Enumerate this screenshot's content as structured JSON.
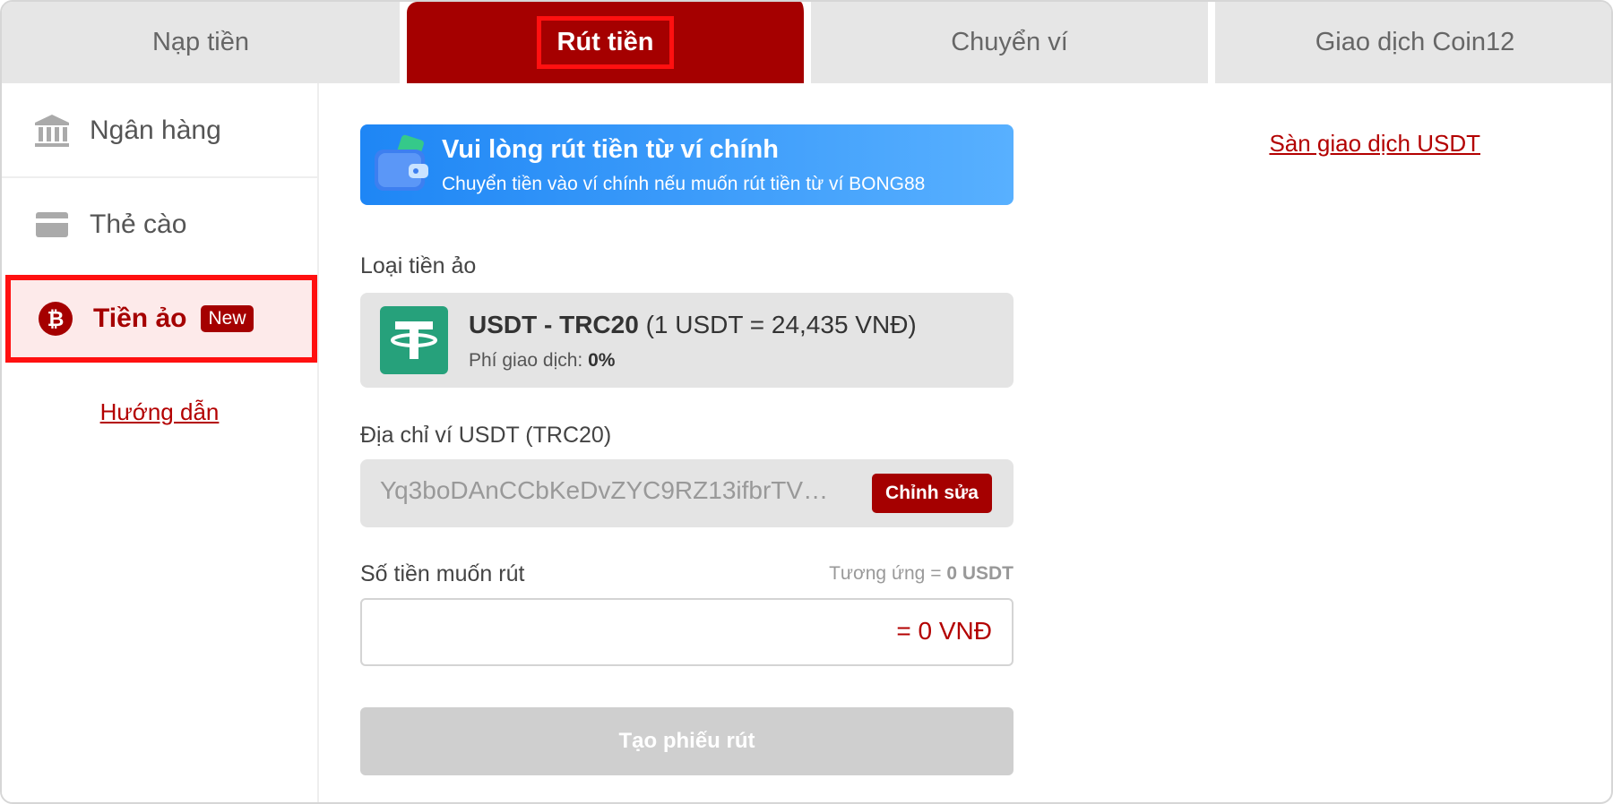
{
  "tabs": [
    {
      "label": "Nạp tiền",
      "active": false
    },
    {
      "label": "Rút tiền",
      "active": true
    },
    {
      "label": "Chuyển ví",
      "active": false
    },
    {
      "label": "Giao dịch Coin12",
      "active": false
    }
  ],
  "sidebar": {
    "items": [
      {
        "label": "Ngân hàng",
        "icon": "bank-icon"
      },
      {
        "label": "Thẻ cào",
        "icon": "card-icon"
      },
      {
        "label": "Tiền ảo",
        "icon": "bitcoin-icon",
        "badge": "New",
        "selected": true
      }
    ],
    "guide_link": "Hướng dẫn"
  },
  "banner": {
    "title": "Vui lòng rút tiền từ ví chính",
    "subtitle": "Chuyển tiền vào ví chính nếu muốn rút tiền từ ví BONG88",
    "icon": "wallet-icon"
  },
  "exchange_link": "Sàn giao dịch USDT",
  "coin": {
    "label": "Loại tiền ảo",
    "name": "USDT - TRC20",
    "rate": "(1 USDT = 24,435 VNĐ)",
    "fee_label": "Phí giao dịch:",
    "fee_value": "0%",
    "icon": "tether-icon"
  },
  "address": {
    "label": "Địa chỉ ví USDT (TRC20)",
    "value": "Yq3boDAnCCbKeDvZYC9RZ13ifbrTV…",
    "edit_label": "Chỉnh sửa"
  },
  "amount": {
    "label": "Số tiền muốn rút",
    "equiv_label": "Tương ứng =",
    "equiv_value": "0 USDT",
    "value": "= 0 VNĐ"
  },
  "submit_label": "Tạo phiếu rút",
  "colors": {
    "brand": "#a50000",
    "highlight": "#ff1010",
    "banner_start": "#1e86f5",
    "banner_end": "#58b0ff",
    "tether": "#26a17b"
  }
}
